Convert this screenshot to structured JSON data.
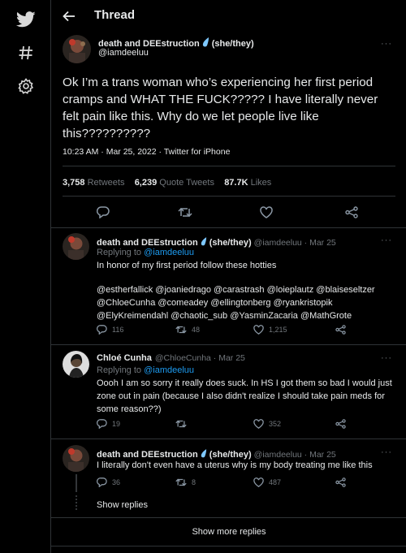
{
  "header": {
    "title": "Thread"
  },
  "main_tweet": {
    "name": "death and DEEstruction",
    "pronouns": "(she/they)",
    "handle": "@iamdeeluu",
    "text": "Ok I’m a trans woman who’s experiencing her first period cramps and WHAT THE FUCK????? I have literally never felt pain like this. Why do we let people live like this??????????",
    "meta": "10:23 AM · Mar 25, 2022 · Twitter for iPhone",
    "retweets": "3,758",
    "retweets_label": "Retweets",
    "quotes": "6,239",
    "quotes_label": "Quote Tweets",
    "likes": "87.7K",
    "likes_label": "Likes"
  },
  "replies": [
    {
      "name": "death and DEEstruction",
      "pronouns": "(she/they)",
      "handle_date": "@iamdeeluu · Mar 25",
      "replying_prefix": "Replying to",
      "replying_handle": "@iamdeeluu",
      "text": "In honor of my first period follow these hotties",
      "mentions": "@estherfallick @joaniedrago @carastrash @loieplautz @blaiseseltzer @ChloeCunha @comeadey @ellingtonberg @ryankristopik @ElyKreimendahl @chaotic_sub @YasminZacaria @MathGrote",
      "replies": "116",
      "retweets": "48",
      "likes": "1,215"
    },
    {
      "name": "Chloé Cunha",
      "handle_date": "@ChloeCunha · Mar 25",
      "replying_prefix": "Replying to",
      "replying_handle": "@iamdeeluu",
      "text": "Oooh I am so sorry it really does suck. In HS I got them so bad I would just zone out in pain (because I also didn't realize I should take pain meds for some reason??)",
      "replies": "19",
      "retweets": "",
      "likes": "352"
    },
    {
      "name": "death and DEEstruction",
      "pronouns": "(she/they)",
      "handle_date": "@iamdeeluu · Mar 25",
      "text": "I literally don't even have a uterus why is my body treating me like this",
      "replies": "36",
      "retweets": "8",
      "likes": "487"
    }
  ],
  "show_replies": "Show replies",
  "show_more_replies": "Show more replies",
  "colors": {
    "accent": "#1d9bf0",
    "muted": "#71767b",
    "text": "#e7e9ea",
    "border": "#2f3336"
  }
}
